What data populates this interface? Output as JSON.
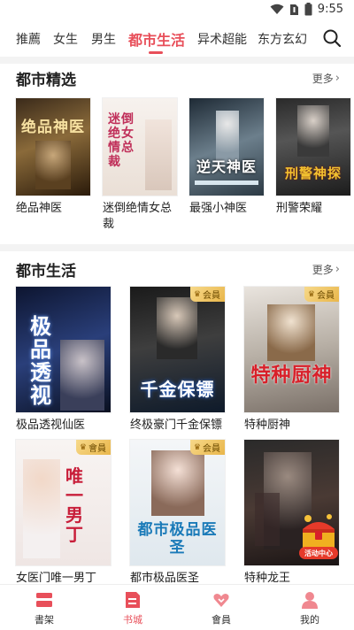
{
  "status": {
    "time": "9:55"
  },
  "tabs": [
    {
      "label": "推薦"
    },
    {
      "label": "女生"
    },
    {
      "label": "男生"
    },
    {
      "label": "都市生活",
      "active": true
    },
    {
      "label": "异术超能"
    },
    {
      "label": "东方玄幻"
    }
  ],
  "section1": {
    "title": "都市精选",
    "more": "更多",
    "books": [
      {
        "title": "绝品神医",
        "cover_text": "绝品神医"
      },
      {
        "title": "迷倒绝情女总裁",
        "cover_text": "迷倒绝女情总裁"
      },
      {
        "title": "最强小神医",
        "cover_text": "逆天神医"
      },
      {
        "title": "刑警荣耀",
        "cover_text": "刑警神探"
      }
    ]
  },
  "section2": {
    "title": "都市生活",
    "more": "更多",
    "books": [
      {
        "title": "极品透视仙医",
        "cover_text": "极品透视",
        "vip": false
      },
      {
        "title": "终极豪门千金保镖",
        "cover_text": "千金保镖",
        "vip": true,
        "badge": "会員"
      },
      {
        "title": "特种厨神",
        "cover_text": "特种厨神",
        "vip": true,
        "badge": "会員"
      },
      {
        "title": "女医门唯一男丁",
        "cover_text": "唯一男丁",
        "vip": true,
        "badge": "會員"
      },
      {
        "title": "都市极品医圣",
        "cover_text": "都市极品医圣",
        "vip": true,
        "badge": "会員"
      },
      {
        "title": "特种龙王",
        "cover_text": "",
        "vip": false
      }
    ]
  },
  "float_badge": {
    "label": "活动中心"
  },
  "bottom_nav": [
    {
      "label": "書架",
      "icon": "bookshelf-icon"
    },
    {
      "label": "书城",
      "icon": "bookstore-icon",
      "active": true
    },
    {
      "label": "會員",
      "icon": "vip-heart-icon"
    },
    {
      "label": "我的",
      "icon": "profile-icon"
    }
  ],
  "colors": {
    "accent": "#e84f5a",
    "vip_gold": "#e9b64a"
  }
}
